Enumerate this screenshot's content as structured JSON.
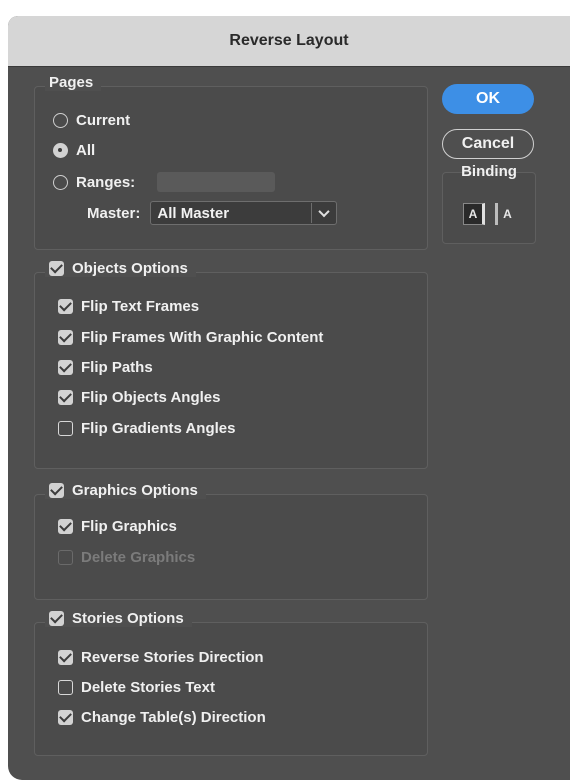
{
  "dialog": {
    "title": "Reverse Layout"
  },
  "buttons": {
    "ok": "OK",
    "cancel": "Cancel"
  },
  "binding": {
    "label": "Binding",
    "left_glyph": "A",
    "right_glyph": "A",
    "selected": "left"
  },
  "pages": {
    "label": "Pages",
    "current": "Current",
    "all": "All",
    "ranges": "Ranges:",
    "ranges_value": "",
    "selected": "all",
    "master_label": "Master:",
    "master_value": "All Master"
  },
  "objects": {
    "label": "Objects Options",
    "checked": true,
    "items": [
      {
        "label": "Flip Text Frames",
        "checked": true
      },
      {
        "label": "Flip Frames With Graphic Content",
        "checked": true
      },
      {
        "label": "Flip Paths",
        "checked": true
      },
      {
        "label": "Flip Objects Angles",
        "checked": true
      },
      {
        "label": "Flip Gradients Angles",
        "checked": false
      }
    ]
  },
  "graphics": {
    "label": "Graphics Options",
    "checked": true,
    "items": [
      {
        "label": "Flip Graphics",
        "checked": true
      },
      {
        "label": "Delete Graphics",
        "checked": false,
        "disabled": true
      }
    ]
  },
  "stories": {
    "label": "Stories Options",
    "checked": true,
    "items": [
      {
        "label": "Reverse Stories Direction",
        "checked": true
      },
      {
        "label": "Delete Stories Text",
        "checked": false
      },
      {
        "label": "Change Table(s) Direction",
        "checked": true
      }
    ]
  }
}
